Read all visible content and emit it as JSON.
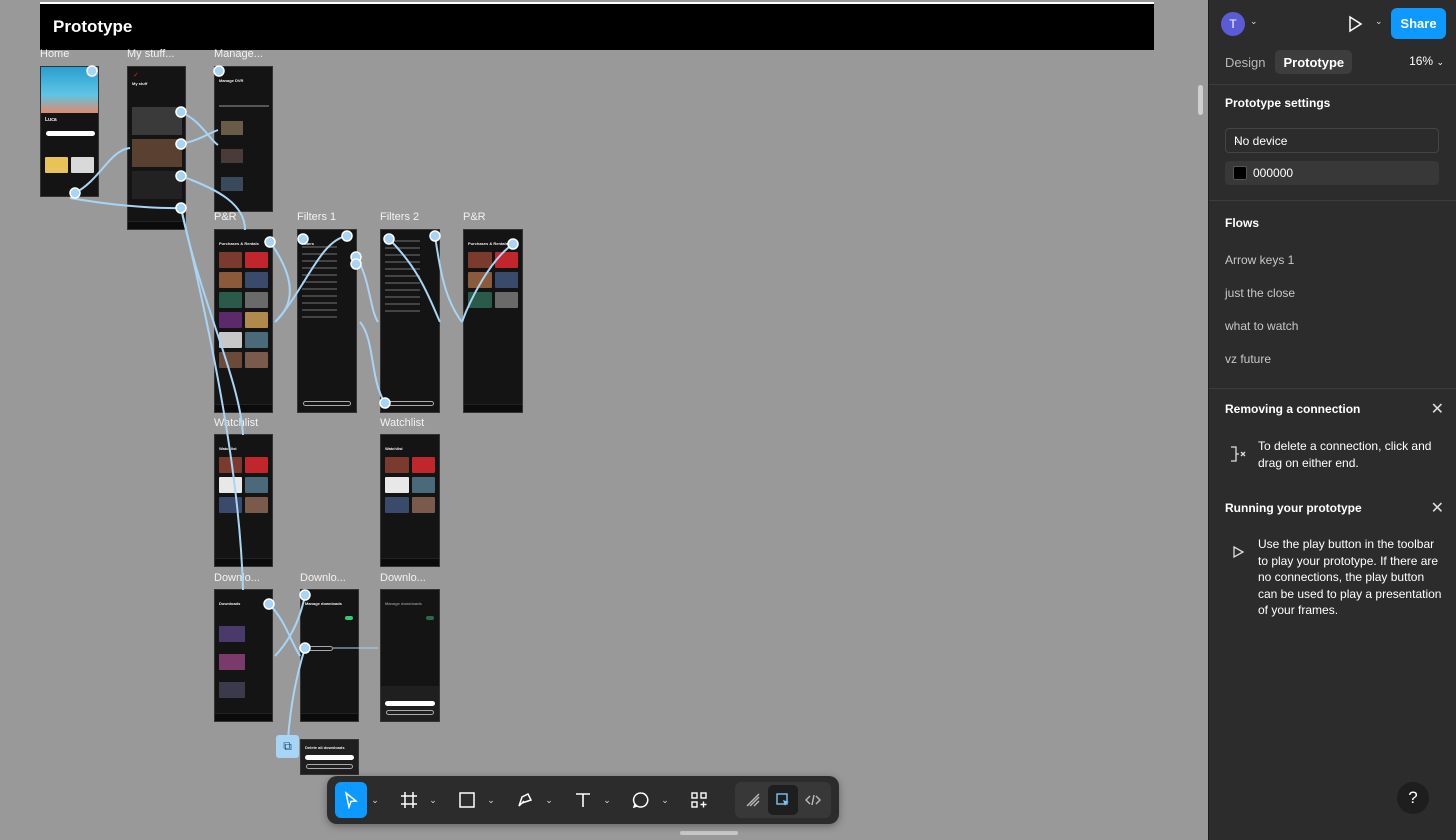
{
  "canvas": {
    "section_title": "Prototype",
    "frame_labels": {
      "home": "Home",
      "my_stuff": "My stuff...",
      "manage": "Manage...",
      "pr_1": "P&R",
      "filters_1": "Filters 1",
      "filters_2": "Filters 2",
      "pr_2": "P&R",
      "watchlist_1": "Watchlist",
      "watchlist_2": "Watchlist",
      "downloads_1": "Downlo...",
      "downloads_2": "Downlo...",
      "downloads_3": "Downlo..."
    },
    "frame_titles": {
      "home": "Luca",
      "my_stuff": "My stuff",
      "manage": "Manage DVR",
      "pr_1": "Purchases & Rentals",
      "filters_1": "Filters",
      "pr_2": "Purchases & Rentals",
      "watchlist_1": "Watchlist",
      "watchlist_2": "Watchlist",
      "downloads_1": "Downloads",
      "downloads_2": "Manage downloads",
      "downloads_3": "Manage downloads",
      "overlay": "Delete all downloads"
    }
  },
  "toolbar": {
    "tools": [
      "move-tool",
      "frame-tool",
      "shape-tool",
      "pen-tool",
      "text-tool",
      "comment-tool",
      "actions-tool"
    ],
    "modes": [
      "draw-mode",
      "design-mode",
      "dev-mode"
    ]
  },
  "panel": {
    "avatar_initial": "T",
    "share_label": "Share",
    "tabs": [
      "Design",
      "Prototype"
    ],
    "active_tab": "Prototype",
    "zoom": "16%",
    "prototype_settings": {
      "title": "Prototype settings",
      "device": "No device",
      "background_color": "000000"
    },
    "flows": {
      "title": "Flows",
      "items": [
        "Arrow keys 1",
        "just the close",
        "what to watch",
        "vz future"
      ]
    },
    "tips": [
      {
        "title": "Removing a connection",
        "text": "To delete a connection, click and drag on either end."
      },
      {
        "title": "Running your prototype",
        "text": "Use the play button in the toolbar to play your prototype. If there are no connections, the play button can be used to play a presentation of your frames."
      }
    ],
    "help_label": "?"
  },
  "colors": {
    "accent": "#0d99ff",
    "canvas_bg": "#999999",
    "panel_bg": "#2c2c2c",
    "wire": "#a8d4f5"
  }
}
